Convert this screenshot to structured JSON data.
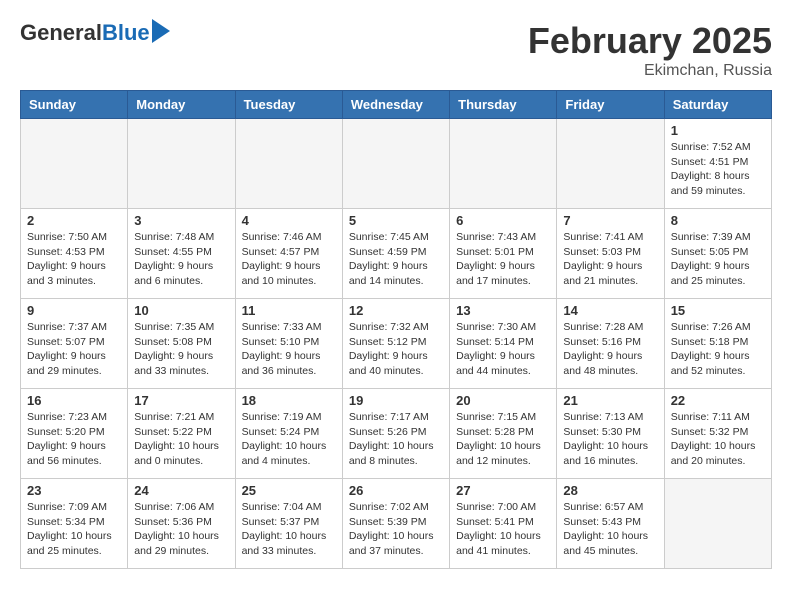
{
  "logo": {
    "general": "General",
    "blue": "Blue"
  },
  "title": {
    "month_year": "February 2025",
    "location": "Ekimchan, Russia"
  },
  "headers": [
    "Sunday",
    "Monday",
    "Tuesday",
    "Wednesday",
    "Thursday",
    "Friday",
    "Saturday"
  ],
  "weeks": [
    [
      {
        "day": "",
        "info": ""
      },
      {
        "day": "",
        "info": ""
      },
      {
        "day": "",
        "info": ""
      },
      {
        "day": "",
        "info": ""
      },
      {
        "day": "",
        "info": ""
      },
      {
        "day": "",
        "info": ""
      },
      {
        "day": "1",
        "info": "Sunrise: 7:52 AM\nSunset: 4:51 PM\nDaylight: 8 hours and 59 minutes."
      }
    ],
    [
      {
        "day": "2",
        "info": "Sunrise: 7:50 AM\nSunset: 4:53 PM\nDaylight: 9 hours and 3 minutes."
      },
      {
        "day": "3",
        "info": "Sunrise: 7:48 AM\nSunset: 4:55 PM\nDaylight: 9 hours and 6 minutes."
      },
      {
        "day": "4",
        "info": "Sunrise: 7:46 AM\nSunset: 4:57 PM\nDaylight: 9 hours and 10 minutes."
      },
      {
        "day": "5",
        "info": "Sunrise: 7:45 AM\nSunset: 4:59 PM\nDaylight: 9 hours and 14 minutes."
      },
      {
        "day": "6",
        "info": "Sunrise: 7:43 AM\nSunset: 5:01 PM\nDaylight: 9 hours and 17 minutes."
      },
      {
        "day": "7",
        "info": "Sunrise: 7:41 AM\nSunset: 5:03 PM\nDaylight: 9 hours and 21 minutes."
      },
      {
        "day": "8",
        "info": "Sunrise: 7:39 AM\nSunset: 5:05 PM\nDaylight: 9 hours and 25 minutes."
      }
    ],
    [
      {
        "day": "9",
        "info": "Sunrise: 7:37 AM\nSunset: 5:07 PM\nDaylight: 9 hours and 29 minutes."
      },
      {
        "day": "10",
        "info": "Sunrise: 7:35 AM\nSunset: 5:08 PM\nDaylight: 9 hours and 33 minutes."
      },
      {
        "day": "11",
        "info": "Sunrise: 7:33 AM\nSunset: 5:10 PM\nDaylight: 9 hours and 36 minutes."
      },
      {
        "day": "12",
        "info": "Sunrise: 7:32 AM\nSunset: 5:12 PM\nDaylight: 9 hours and 40 minutes."
      },
      {
        "day": "13",
        "info": "Sunrise: 7:30 AM\nSunset: 5:14 PM\nDaylight: 9 hours and 44 minutes."
      },
      {
        "day": "14",
        "info": "Sunrise: 7:28 AM\nSunset: 5:16 PM\nDaylight: 9 hours and 48 minutes."
      },
      {
        "day": "15",
        "info": "Sunrise: 7:26 AM\nSunset: 5:18 PM\nDaylight: 9 hours and 52 minutes."
      }
    ],
    [
      {
        "day": "16",
        "info": "Sunrise: 7:23 AM\nSunset: 5:20 PM\nDaylight: 9 hours and 56 minutes."
      },
      {
        "day": "17",
        "info": "Sunrise: 7:21 AM\nSunset: 5:22 PM\nDaylight: 10 hours and 0 minutes."
      },
      {
        "day": "18",
        "info": "Sunrise: 7:19 AM\nSunset: 5:24 PM\nDaylight: 10 hours and 4 minutes."
      },
      {
        "day": "19",
        "info": "Sunrise: 7:17 AM\nSunset: 5:26 PM\nDaylight: 10 hours and 8 minutes."
      },
      {
        "day": "20",
        "info": "Sunrise: 7:15 AM\nSunset: 5:28 PM\nDaylight: 10 hours and 12 minutes."
      },
      {
        "day": "21",
        "info": "Sunrise: 7:13 AM\nSunset: 5:30 PM\nDaylight: 10 hours and 16 minutes."
      },
      {
        "day": "22",
        "info": "Sunrise: 7:11 AM\nSunset: 5:32 PM\nDaylight: 10 hours and 20 minutes."
      }
    ],
    [
      {
        "day": "23",
        "info": "Sunrise: 7:09 AM\nSunset: 5:34 PM\nDaylight: 10 hours and 25 minutes."
      },
      {
        "day": "24",
        "info": "Sunrise: 7:06 AM\nSunset: 5:36 PM\nDaylight: 10 hours and 29 minutes."
      },
      {
        "day": "25",
        "info": "Sunrise: 7:04 AM\nSunset: 5:37 PM\nDaylight: 10 hours and 33 minutes."
      },
      {
        "day": "26",
        "info": "Sunrise: 7:02 AM\nSunset: 5:39 PM\nDaylight: 10 hours and 37 minutes."
      },
      {
        "day": "27",
        "info": "Sunrise: 7:00 AM\nSunset: 5:41 PM\nDaylight: 10 hours and 41 minutes."
      },
      {
        "day": "28",
        "info": "Sunrise: 6:57 AM\nSunset: 5:43 PM\nDaylight: 10 hours and 45 minutes."
      },
      {
        "day": "",
        "info": ""
      }
    ]
  ]
}
